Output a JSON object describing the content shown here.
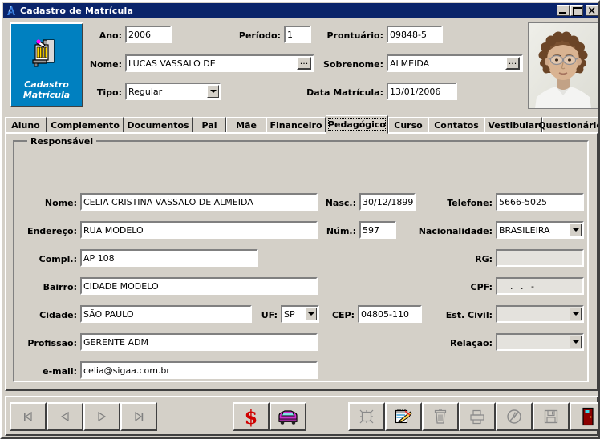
{
  "window": {
    "title": "Cadastro de Matrícula",
    "icon": "app-icon",
    "buttons": [
      {
        "name": "minimize-button",
        "label": "Minimizar"
      },
      {
        "name": "maximize-button",
        "label": "Maximizar"
      },
      {
        "name": "close-button",
        "label": "Fechar"
      }
    ]
  },
  "logo": {
    "line1": "Cadastro",
    "line2": "Matrícula",
    "bg_color": "#0080c0",
    "icon": "register-writing-icon"
  },
  "header": {
    "ano": {
      "label": "Ano:",
      "value": "2006"
    },
    "periodo": {
      "label": "Período:",
      "value": "1"
    },
    "prontuario": {
      "label": "Prontuário:",
      "value": "09848-5"
    },
    "nome": {
      "label": "Nome:",
      "value": "LUCAS VASSALO DE",
      "browse": "..."
    },
    "sobrenome": {
      "label": "Sobrenome:",
      "value": "ALMEIDA",
      "browse": "..."
    },
    "tipo": {
      "label": "Tipo:",
      "value": "Regular"
    },
    "data_matricula": {
      "label": "Data Matrícula:",
      "value": "13/01/2006"
    },
    "photo_alt": "Foto do aluno"
  },
  "tabs": [
    {
      "label": "Aluno",
      "selected": false
    },
    {
      "label": "Complemento",
      "selected": false
    },
    {
      "label": "Documentos",
      "selected": false
    },
    {
      "label": "Pai",
      "selected": false
    },
    {
      "label": "Mãe",
      "selected": false
    },
    {
      "label": "Financeiro",
      "selected": false
    },
    {
      "label": "Pedagógico",
      "selected": true
    },
    {
      "label": "Curso",
      "selected": false
    },
    {
      "label": "Contatos",
      "selected": false
    },
    {
      "label": "Vestibular",
      "selected": false
    },
    {
      "label": "Questionário",
      "selected": false
    }
  ],
  "group": {
    "title": "Responsável",
    "fields": {
      "nome": {
        "label": "Nome:",
        "value": "CELIA CRISTINA VASSALO DE ALMEIDA"
      },
      "nasc": {
        "label": "Nasc.:",
        "value": "30/12/1899"
      },
      "telefone": {
        "label": "Telefone:",
        "value": "5666-5025"
      },
      "endereco": {
        "label": "Endereço:",
        "value": "RUA MODELO"
      },
      "num": {
        "label": "Núm.:",
        "value": "597"
      },
      "nacionalidade": {
        "label": "Nacionalidade:",
        "value": "BRASILEIRA"
      },
      "compl": {
        "label": "Compl.:",
        "value": "AP 108"
      },
      "rg": {
        "label": "RG:",
        "value": ""
      },
      "bairro": {
        "label": "Bairro:",
        "value": "CIDADE MODELO"
      },
      "cpf": {
        "label": "CPF:",
        "value": "   .   .   -"
      },
      "cidade": {
        "label": "Cidade:",
        "value": "SÃO PAULO"
      },
      "uf": {
        "label": "UF:",
        "value": "SP"
      },
      "cep": {
        "label": "CEP:",
        "value": "04805-110"
      },
      "est_civil": {
        "label": "Est. Civil:",
        "value": ""
      },
      "profissao": {
        "label": "Profissão:",
        "value": "GERENTE ADM"
      },
      "relacao": {
        "label": "Relação:",
        "value": ""
      },
      "email": {
        "label": "e-mail:",
        "value": "celia@sigaa.com.br"
      }
    }
  },
  "toolbar": {
    "buttons": [
      {
        "name": "first-record-button",
        "icon": "first-record-icon",
        "enabled": false
      },
      {
        "name": "previous-record-button",
        "icon": "previous-record-icon",
        "enabled": false
      },
      {
        "name": "next-record-button",
        "icon": "next-record-icon",
        "enabled": false
      },
      {
        "name": "last-record-button",
        "icon": "last-record-icon",
        "enabled": false
      },
      {
        "name": "financial-button",
        "icon": "dollar-icon",
        "enabled": true
      },
      {
        "name": "transport-button",
        "icon": "car-icon",
        "enabled": true
      },
      {
        "name": "new-record-button",
        "icon": "new-record-icon",
        "enabled": false
      },
      {
        "name": "edit-record-button",
        "icon": "edit-notepad-icon",
        "enabled": true
      },
      {
        "name": "delete-record-button",
        "icon": "trash-icon",
        "enabled": false
      },
      {
        "name": "print-button",
        "icon": "printer-icon",
        "enabled": false
      },
      {
        "name": "cancel-button",
        "icon": "cancel-circle-icon",
        "enabled": false
      },
      {
        "name": "save-button",
        "icon": "floppy-save-icon",
        "enabled": false
      },
      {
        "name": "exit-button",
        "icon": "exit-door-icon",
        "enabled": true
      }
    ]
  },
  "colors": {
    "titlebar": "#0a246a",
    "face": "#d4d0c8",
    "logo_blue": "#0080c0",
    "accent_red": "#cc0000"
  }
}
